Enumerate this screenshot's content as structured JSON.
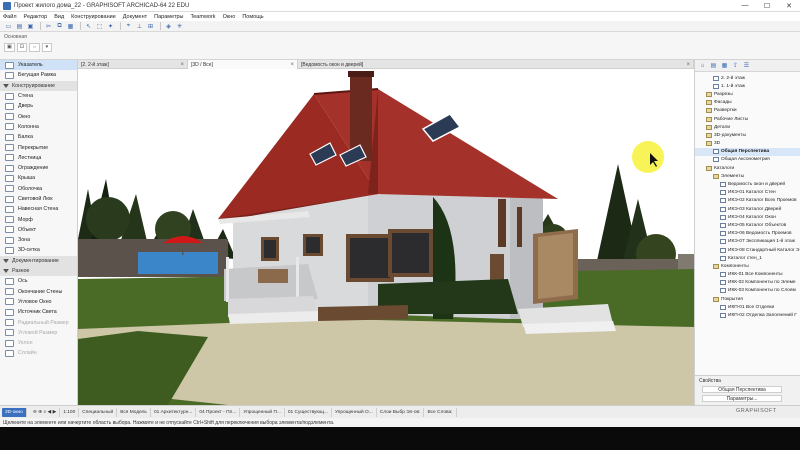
{
  "window": {
    "title": "Проект жилого дома_22 - GRAPHISOFT ARCHICAD-64 22 EDU",
    "minimize": "—",
    "maximize": "☐",
    "close": "✕"
  },
  "menu": [
    "Файл",
    "Редактор",
    "Вид",
    "Конструирование",
    "Документ",
    "Параметры",
    "Teamwork",
    "Окно",
    "Помощь"
  ],
  "infobar": {
    "label": "Основная",
    "buttons": [
      "▣",
      "⊡",
      "⇔",
      "▾"
    ]
  },
  "toolbox": {
    "items": [
      {
        "label": "Указатель",
        "kind": "selected"
      },
      {
        "label": "Бегущая Рамка",
        "kind": "item"
      },
      {
        "label": "Конструирование",
        "kind": "section"
      },
      {
        "label": "Стена",
        "kind": "item"
      },
      {
        "label": "Дверь",
        "kind": "item"
      },
      {
        "label": "Окно",
        "kind": "item"
      },
      {
        "label": "Колонна",
        "kind": "item"
      },
      {
        "label": "Балка",
        "kind": "item"
      },
      {
        "label": "Перекрытие",
        "kind": "item"
      },
      {
        "label": "Лестница",
        "kind": "item"
      },
      {
        "label": "Ограждение",
        "kind": "item"
      },
      {
        "label": "Крыша",
        "kind": "item"
      },
      {
        "label": "Оболочка",
        "kind": "item"
      },
      {
        "label": "Световой Люк",
        "kind": "item"
      },
      {
        "label": "Навесная Стена",
        "kind": "item"
      },
      {
        "label": "Морф",
        "kind": "item"
      },
      {
        "label": "Объект",
        "kind": "item"
      },
      {
        "label": "Зона",
        "kind": "item"
      },
      {
        "label": "3D-сетка",
        "kind": "item"
      },
      {
        "label": "Документирование",
        "kind": "section"
      },
      {
        "label": "Разное",
        "kind": "section"
      },
      {
        "label": "Ось",
        "kind": "item"
      },
      {
        "label": "Окончание Стены",
        "kind": "item"
      },
      {
        "label": "Угловое Окно",
        "kind": "item"
      },
      {
        "label": "Источник Света",
        "kind": "item"
      },
      {
        "label": "Радиальный Размер",
        "kind": "faded"
      },
      {
        "label": "Угловой Размер",
        "kind": "faded"
      },
      {
        "label": "Уклон",
        "kind": "faded"
      },
      {
        "label": "Сплайн",
        "kind": "faded"
      }
    ]
  },
  "tabs": [
    {
      "label": "[2. 2-й этаж]"
    },
    {
      "label": "[3D / Все]"
    },
    {
      "label": "[Ведомость окон и дверей]"
    }
  ],
  "navigator": {
    "items": [
      {
        "label": "2. 2-й этаж",
        "indent": 2,
        "icon": "page"
      },
      {
        "label": "1. 1-й этаж",
        "indent": 2,
        "icon": "page"
      },
      {
        "label": "Разрезы",
        "indent": 1,
        "icon": "folder"
      },
      {
        "label": "Фасады",
        "indent": 1,
        "icon": "folder"
      },
      {
        "label": "Развертки",
        "indent": 1,
        "icon": "folder"
      },
      {
        "label": "Рабочие Листы",
        "indent": 1,
        "icon": "folder"
      },
      {
        "label": "Детали",
        "indent": 1,
        "icon": "folder"
      },
      {
        "label": "3D-документы",
        "indent": 1,
        "icon": "folder"
      },
      {
        "label": "3D",
        "indent": 1,
        "icon": "folder"
      },
      {
        "label": "Общая Перспектива",
        "indent": 2,
        "icon": "page",
        "selected": true
      },
      {
        "label": "Общая Аксонометрия",
        "indent": 2,
        "icon": "page"
      },
      {
        "label": "Каталоги",
        "indent": 1,
        "icon": "folder"
      },
      {
        "label": "Элементы",
        "indent": 2,
        "icon": "folder"
      },
      {
        "label": "Ведомость окон и дверей",
        "indent": 3,
        "icon": "page"
      },
      {
        "label": "ИКЭ-01 Каталог Стен",
        "indent": 3,
        "icon": "page"
      },
      {
        "label": "ИКЭ-02 Каталог Всех Проемов",
        "indent": 3,
        "icon": "page"
      },
      {
        "label": "ИКЭ-03 Каталог Дверей",
        "indent": 3,
        "icon": "page"
      },
      {
        "label": "ИКЭ-04 Каталог Окон",
        "indent": 3,
        "icon": "page"
      },
      {
        "label": "ИКЭ-05 Каталог Объектов",
        "indent": 3,
        "icon": "page"
      },
      {
        "label": "ИКЭ-06 Ведомость Проемов",
        "indent": 3,
        "icon": "page"
      },
      {
        "label": "ИКЭ-07 Экспликация 1-й этаж",
        "indent": 3,
        "icon": "page"
      },
      {
        "label": "ИКЭ-08 Стандартный Каталог Э",
        "indent": 3,
        "icon": "page"
      },
      {
        "label": "Каталог стен_1",
        "indent": 3,
        "icon": "page"
      },
      {
        "label": "Компоненты",
        "indent": 2,
        "icon": "folder"
      },
      {
        "label": "ИКК-01 Все Компоненты",
        "indent": 3,
        "icon": "page"
      },
      {
        "label": "ИКК-02 Компоненты по Элеме",
        "indent": 3,
        "icon": "page"
      },
      {
        "label": "ИКК-03 Компоненты по Слоям",
        "indent": 3,
        "icon": "page"
      },
      {
        "label": "Покрытия",
        "indent": 2,
        "icon": "folder"
      },
      {
        "label": "ИКП-01 Все Отделки",
        "indent": 3,
        "icon": "page"
      },
      {
        "label": "ИКП-02 Отделка Заполнений Г",
        "indent": 3,
        "icon": "page"
      }
    ]
  },
  "navigator_bottom": {
    "properties_label": "Свойства",
    "view_name": "Общая Перспектива",
    "params_button": "Параметры..."
  },
  "statusbar": {
    "mode": "3D-окно",
    "scale": "1:100",
    "items": [
      "Специальный",
      "Вся Модель",
      "01 Архитектурн...",
      "04 Проект - Пл...",
      "Упрощенный П...",
      "01 Существующ...",
      "Упрощенный О..."
    ],
    "render_options": "Слои Выбр Эл-ов:",
    "styles": "Все Слова:"
  },
  "hint": "Щелкните на элементе или начертите область выбора. Нажмите и не отпускайте Ctrl+Shift для переключения выбора элемента/подэлемента.",
  "brand": "GRAPHISOFT",
  "colors": {
    "sky": "#ffffff",
    "roof": "#9b2b22",
    "walls": "#d9dadc",
    "lawn": "#4a6b26",
    "paving": "#cdc6a7",
    "accent": "#3b6fc0"
  }
}
